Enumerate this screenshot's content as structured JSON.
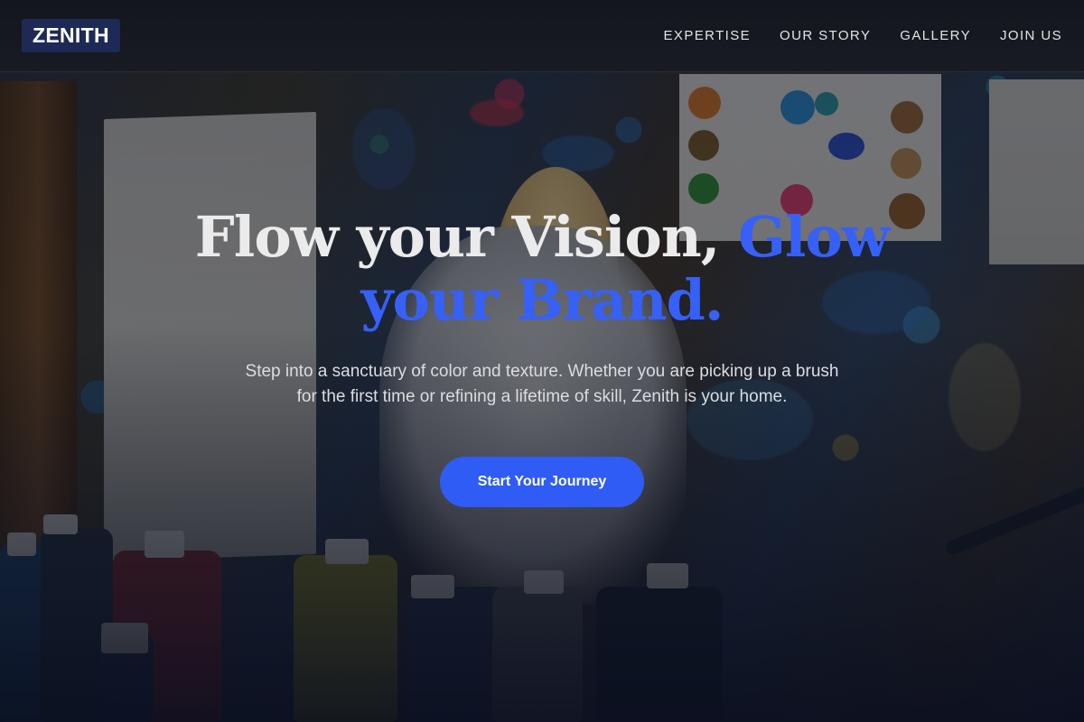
{
  "brand": {
    "logo_text": "ZENITH",
    "accent_color": "#3660f6"
  },
  "nav": {
    "items": [
      {
        "label": "EXPERTISE"
      },
      {
        "label": "OUR STORY"
      },
      {
        "label": "GALLERY"
      },
      {
        "label": "JOIN US"
      }
    ]
  },
  "hero": {
    "headline_part1": "Flow your Vision, ",
    "headline_part2": "Glow your Brand.",
    "subtext": "Step into a sanctuary of color and texture. Whether you are picking up a brush for the first time or refining a lifetime of skill, Zenith is your home.",
    "cta_label": "Start Your Journey",
    "cta_color": "#2f5cf5"
  }
}
